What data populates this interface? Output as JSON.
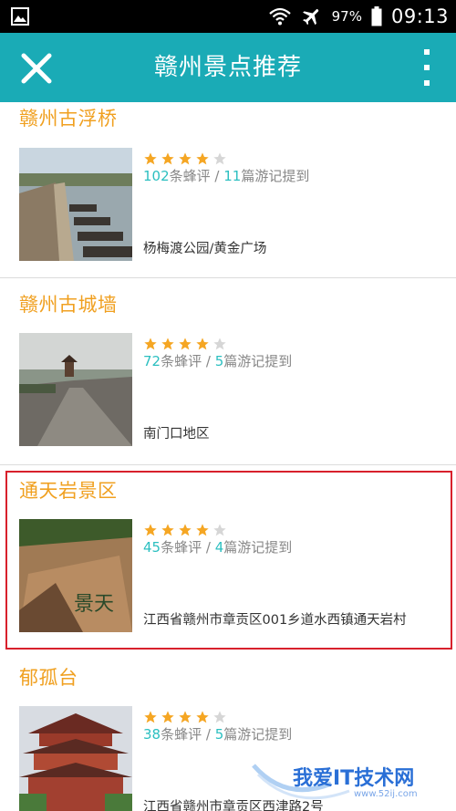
{
  "status_bar": {
    "battery_percent": "97%",
    "time": "09:13",
    "icons": [
      "gallery-icon",
      "wifi-icon",
      "airplane-mode-icon",
      "battery-icon"
    ]
  },
  "app_bar": {
    "title": "赣州景点推荐",
    "background_color": "#1aabb6",
    "icons": [
      "close-icon",
      "more-vert-icon"
    ]
  },
  "spots": [
    {
      "name": "赣州古浮桥",
      "rating": 4,
      "rating_max": 5,
      "review_count": "102",
      "review_label": "条蜂评",
      "separator": " / ",
      "travelogue_count": "11",
      "travelogue_label": "篇游记提到",
      "address": "杨梅渡公园/黄金广场"
    },
    {
      "name": "赣州古城墙",
      "rating": 4,
      "rating_max": 5,
      "review_count": "72",
      "review_label": "条蜂评",
      "separator": " / ",
      "travelogue_count": "5",
      "travelogue_label": "篇游记提到",
      "address": "南门口地区"
    },
    {
      "name": "通天岩景区",
      "rating": 4,
      "rating_max": 5,
      "review_count": "45",
      "review_label": "条蜂评",
      "separator": " / ",
      "travelogue_count": "4",
      "travelogue_label": "篇游记提到",
      "address": "江西省赣州市章贡区001乡道水西镇通天岩村",
      "highlighted": true
    },
    {
      "name": "郁孤台",
      "rating": 4,
      "rating_max": 5,
      "review_count": "38",
      "review_label": "条蜂评",
      "separator": " / ",
      "travelogue_count": "5",
      "travelogue_label": "篇游记提到",
      "address": "江西省赣州市章贡区西津路2号"
    }
  ],
  "colors": {
    "title_orange": "#f0a020",
    "count_teal": "#2bbfc0",
    "star_filled": "#f5a623",
    "star_empty": "#d6d6d6",
    "highlight_red": "#d8202c"
  },
  "watermark": {
    "text": "我爱IT技术网",
    "sub": "www.52ij.com"
  }
}
